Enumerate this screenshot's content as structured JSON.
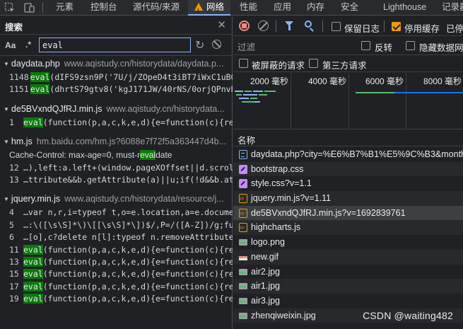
{
  "topbar": {
    "tabs": [
      {
        "label": "元素"
      },
      {
        "label": "控制台"
      },
      {
        "label": "源代码/来源"
      },
      {
        "label": "网络"
      },
      {
        "label": "性能"
      },
      {
        "label": "应用"
      },
      {
        "label": "内存"
      },
      {
        "label": "安全"
      },
      {
        "label": "Lighthouse"
      },
      {
        "label": "记录器"
      }
    ],
    "active_tab": "网络"
  },
  "search_panel": {
    "title": "搜索",
    "case_toggle": "Aa",
    "regex_toggle": ".*",
    "query": "eval",
    "groups": [
      {
        "file": "daydata.php",
        "url": "www.aqistudy.cn/historydata/daydata.p...",
        "lines": [
          {
            "num": "1148",
            "pre": "",
            "match": "eval",
            "post": "(dIFS9zsn9P('7U/j/ZOpeD4t3iBT7iWxC1uBGJ..."
          },
          {
            "num": "1151",
            "pre": "",
            "match": "eval",
            "post": "(dhrtS79gtv8('kgJ171JW/40rNS/0orjQPnvBjU..."
          }
        ]
      },
      {
        "file": "de5BVxndQJfRJ.min.js",
        "url": "www.aqistudy.cn/historydata...",
        "lines": [
          {
            "num": "1",
            "pre": "",
            "match": "eval",
            "post": "(function(p,a,c,k,e,d){e=function(c){return c.toStri..."
          }
        ]
      },
      {
        "file": "hm.js",
        "url": "hm.baidu.com/hm.js?6088e7f72f5a363447d4b...",
        "lines": [
          {
            "num": "",
            "pre": "Cache-Control:   max-age=0, must-r",
            "match": "eval",
            "post": "date"
          },
          {
            "num": "12",
            "pre": "…),left:a.left+(window.pageXOffset||d.scrollLeft)-(d.cl...",
            "match": "",
            "post": ""
          },
          {
            "num": "13",
            "pre": "…ttribute&&b.getAttribute(a)||u;if(!d&&b.attributes&&...",
            "match": "",
            "post": ""
          }
        ]
      },
      {
        "file": "jquery.min.js",
        "url": "www.aqistudy.cn/historydata/resource/j...",
        "lines": [
          {
            "num": "4",
            "pre": "…var n,r,i=typeof t,o=e.location,a=e.document,s=a.d...",
            "match": "",
            "post": ""
          },
          {
            "num": "5",
            "pre": "…:\\([\\s\\S]*\\)\\[[\\s\\S]*\\])$/,P=/([A-Z])/g;function R(e,n,r,i)...",
            "match": "",
            "post": ""
          },
          {
            "num": "6",
            "pre": "…[o],c?delete n[l]:typeof n.removeAttribute!==i?n.rem...",
            "match": "",
            "post": ""
          },
          {
            "num": "11",
            "pre": "",
            "match": "eval",
            "post": "(function(p,a,c,k,e,d){e=function(c){return(c<a?'':..."
          },
          {
            "num": "13",
            "pre": "",
            "match": "eval",
            "post": "(function(p,a,c,k,e,d){e=function(c){return(c<a?\"\"..."
          },
          {
            "num": "15",
            "pre": "",
            "match": "eval",
            "post": "(function(p,a,c,k,e,d){e=function(c){return(c<a?\"\"..."
          },
          {
            "num": "17",
            "pre": "",
            "match": "eval",
            "post": "(function(p,a,c,k,e,d){e=function(c){return(c<a?\"\"..."
          },
          {
            "num": "19",
            "pre": "",
            "match": "eval",
            "post": "(function(p,a,c,k,e,d){e=function(c){return(c<a?\"\"..."
          }
        ]
      }
    ]
  },
  "network": {
    "preserve_log_label": "保留日志",
    "disable_cache_label": "停用缓存",
    "throttle_label": "已停",
    "filter_placeholder": "过滤",
    "invert_label": "反转",
    "hide_data_urls_label": "隐藏数据网址",
    "hide_blocked_label": "被屏蔽的请求",
    "third_party_label": "第三方请求",
    "timeline_labels": [
      "2000 毫秒",
      "4000 毫秒",
      "6000 毫秒",
      "8000 毫秒"
    ],
    "column_name": "名称",
    "requests": [
      {
        "name": "daydata.php?city=%E6%B7%B1%E5%9C%B3&month=",
        "type": "doc"
      },
      {
        "name": "bootstrap.css",
        "type": "css"
      },
      {
        "name": "style.css?v=1.1",
        "type": "css"
      },
      {
        "name": "jquery.min.js?v=1.11",
        "type": "js"
      },
      {
        "name": "de5BVxndQJfRJ.min.js?v=1692839761",
        "type": "js"
      },
      {
        "name": "highcharts.js",
        "type": "js"
      },
      {
        "name": "logo.png",
        "type": "img"
      },
      {
        "name": "new.gif",
        "type": "gif"
      },
      {
        "name": "air2.jpg",
        "type": "img"
      },
      {
        "name": "air1.jpg",
        "type": "img"
      },
      {
        "name": "air3.jpg",
        "type": "img"
      },
      {
        "name": "zhenqiweixin.jpg",
        "type": "img"
      }
    ],
    "selected_index": 4
  },
  "watermark": "CSDN @waiting482"
}
